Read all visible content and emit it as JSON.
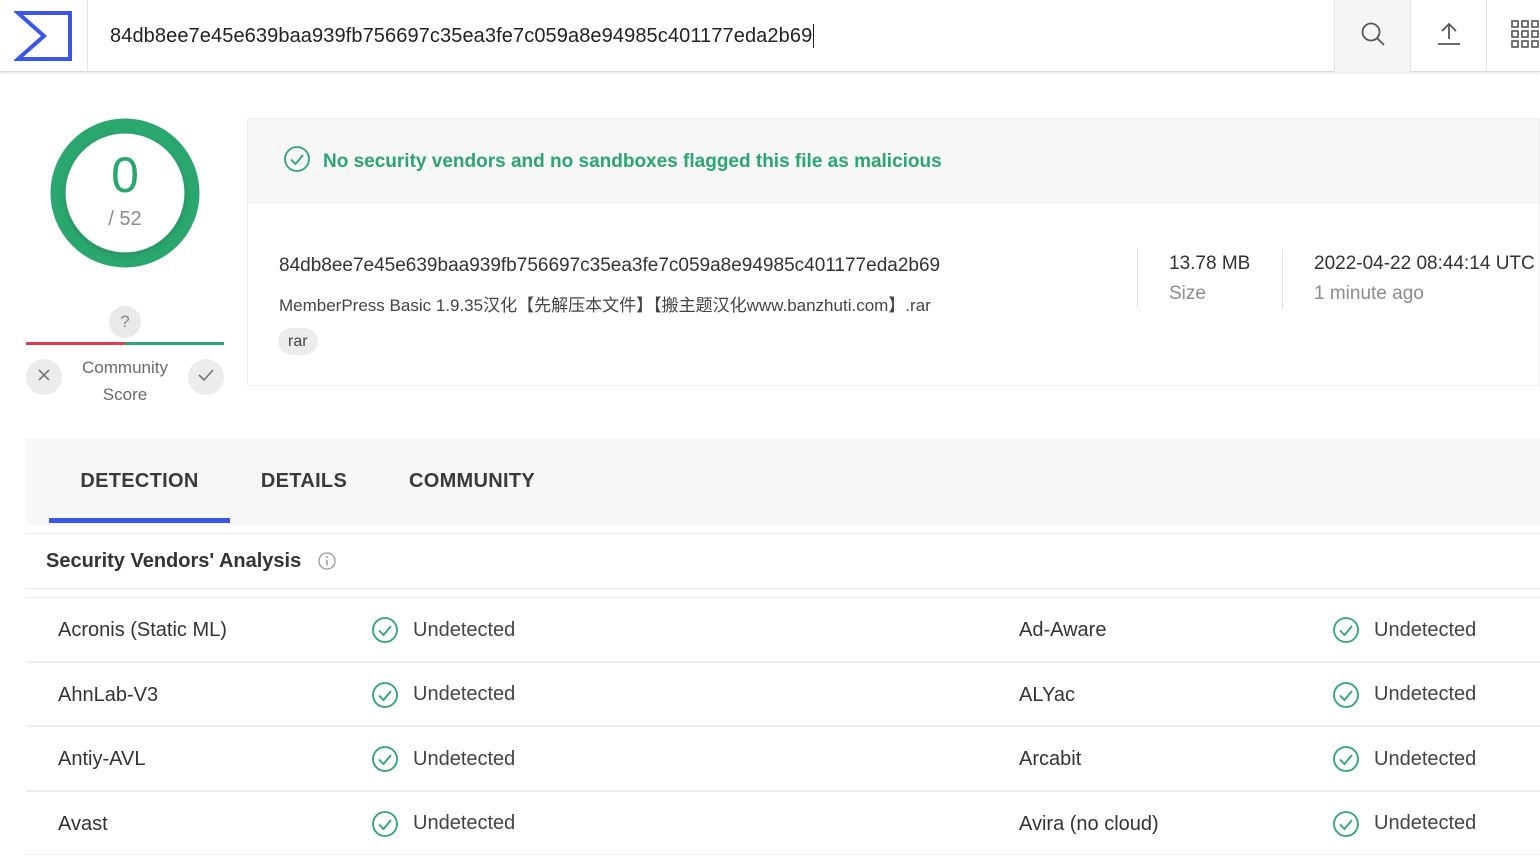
{
  "search": {
    "value": "84db8ee7e45e639baa939fb756697c35ea3fe7c059a8e94985c401177eda2b69"
  },
  "icons": {
    "logo": "virustotal-logo-icon",
    "search": "search-icon",
    "upload": "upload-icon",
    "apps": "apps-grid-icon"
  },
  "score": {
    "detections": "0",
    "total": "/ 52"
  },
  "community": {
    "question": "?",
    "label": "Community Score"
  },
  "banner": {
    "text": "No security vendors and no sandboxes flagged this file as malicious"
  },
  "file": {
    "hash": "84db8ee7e45e639baa939fb756697c35ea3fe7c059a8e94985c401177eda2b69",
    "name": "MemberPress Basic 1.9.35汉化【先解压本文件】【搬主题汉化www.banzhuti.com】.rar",
    "tag": "rar",
    "size": "13.78 MB",
    "size_label": "Size",
    "date": "2022-04-22 08:44:14 UTC",
    "date_label": "1 minute ago"
  },
  "tabs": [
    {
      "label": "DETECTION",
      "active": true
    },
    {
      "label": "DETAILS",
      "active": false
    },
    {
      "label": "COMMUNITY",
      "active": false
    }
  ],
  "analysis": {
    "title": "Security Vendors' Analysis",
    "rows": [
      {
        "left_vendor": "Acronis (Static ML)",
        "left_result": "Undetected",
        "right_vendor": "Ad-Aware",
        "right_result": "Undetected"
      },
      {
        "left_vendor": "AhnLab-V3",
        "left_result": "Undetected",
        "right_vendor": "ALYac",
        "right_result": "Undetected"
      },
      {
        "left_vendor": "Antiy-AVL",
        "left_result": "Undetected",
        "right_vendor": "Arcabit",
        "right_result": "Undetected"
      },
      {
        "left_vendor": "Avast",
        "left_result": "Undetected",
        "right_vendor": "Avira (no cloud)",
        "right_result": "Undetected"
      }
    ]
  },
  "colors": {
    "accent_green": "#2aa66f",
    "accent_red": "#e53950",
    "tab_underline": "#3a57e8",
    "logo_blue": "#3a57e8"
  }
}
